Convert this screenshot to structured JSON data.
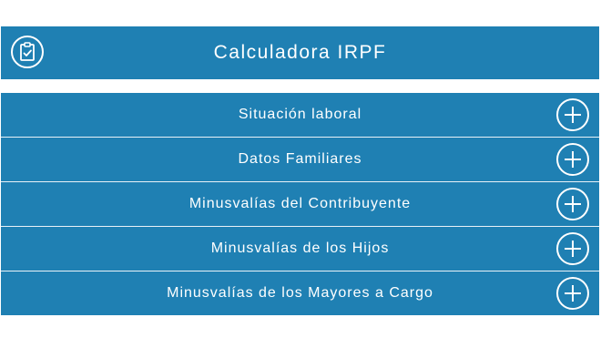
{
  "header": {
    "title": "Calculadora IRPF",
    "icon": "clipboard-check-icon"
  },
  "colors": {
    "primary": "#1f80b3",
    "text": "#ffffff",
    "background": "#ffffff"
  },
  "sections": [
    {
      "label": "Situación laboral",
      "icon": "plus-circle-icon"
    },
    {
      "label": "Datos Familiares",
      "icon": "plus-circle-icon"
    },
    {
      "label": "Minusvalías del Contribuyente",
      "icon": "plus-circle-icon"
    },
    {
      "label": "Minusvalías de los Hijos",
      "icon": "plus-circle-icon"
    },
    {
      "label": "Minusvalías de los Mayores a Cargo",
      "icon": "plus-circle-icon"
    }
  ]
}
